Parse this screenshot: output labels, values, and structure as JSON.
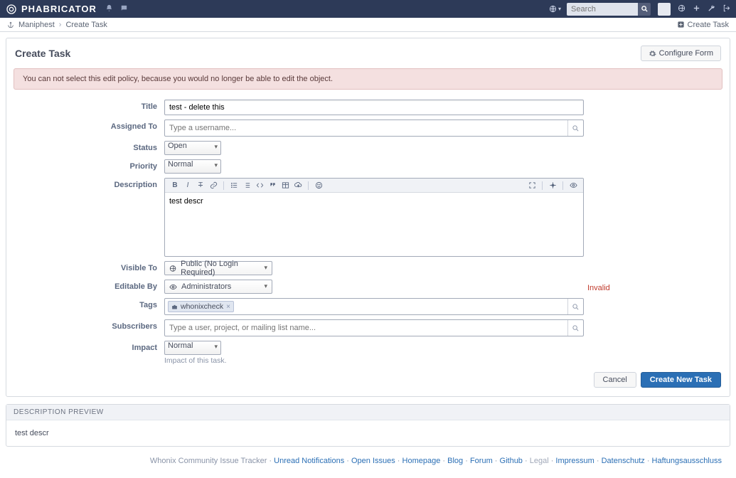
{
  "brand": "PHABRICATOR",
  "search": {
    "placeholder": "Search"
  },
  "crumbs": {
    "app": "Maniphest",
    "page": "Create Task",
    "action": "Create Task"
  },
  "page": {
    "title": "Create Task",
    "configure_label": "Configure Form"
  },
  "error": "You can not select this edit policy, because you would no longer be able to edit the object.",
  "form": {
    "title": {
      "label": "Title",
      "value": "test - delete this"
    },
    "assigned": {
      "label": "Assigned To",
      "placeholder": "Type a username..."
    },
    "status": {
      "label": "Status",
      "value": "Open"
    },
    "priority": {
      "label": "Priority",
      "value": "Normal"
    },
    "description": {
      "label": "Description",
      "value": "test descr"
    },
    "visible": {
      "label": "Visible To",
      "value": "Public (No Login Required)"
    },
    "editable": {
      "label": "Editable By",
      "value": "Administrators",
      "invalid": "Invalid"
    },
    "tags": {
      "label": "Tags",
      "chip": "whonixcheck"
    },
    "subscribers": {
      "label": "Subscribers",
      "placeholder": "Type a user, project, or mailing list name..."
    },
    "impact": {
      "label": "Impact",
      "value": "Normal",
      "helper": "Impact of this task."
    }
  },
  "actions": {
    "cancel": "Cancel",
    "submit": "Create New Task"
  },
  "preview": {
    "header": "DESCRIPTION PREVIEW",
    "body": "test descr"
  },
  "footer": {
    "prefix": "Whonix Community Issue Tracker",
    "links": [
      "Unread Notifications",
      "Open Issues",
      "Homepage",
      "Blog",
      "Forum",
      "Github"
    ],
    "legal_label": "Legal",
    "legal_links": [
      "Impressum",
      "Datenschutz",
      "Haftungsausschluss"
    ]
  }
}
